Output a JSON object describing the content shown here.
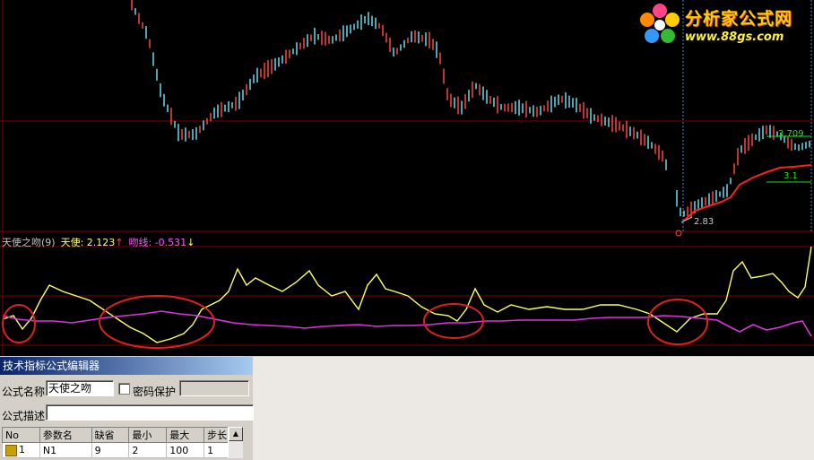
{
  "logo": {
    "title": "分析家公式网",
    "url": "www.88gs.com"
  },
  "indicator": {
    "name": "天使之吻(9)",
    "angel_label": "天使: 2.123",
    "kiss_label": "吻线: -0.531",
    "up_arrow": "↑",
    "down_arrow": "↓"
  },
  "price": {
    "low_label": "2.83",
    "tag_high": "3.709",
    "tag_low": "3.1"
  },
  "colors": {
    "angel": "#ffff66",
    "kiss": "#dd33dd",
    "ma": "#ff2020",
    "circle": "#e02020"
  },
  "editor": {
    "title": "技术指标公式编辑器",
    "formula_name_label": "公式名称",
    "formula_name_value": "天使之吻",
    "password_label": "密码保护",
    "description_label": "公式描述",
    "table": {
      "headers": [
        "No",
        "参数名",
        "缺省",
        "最小",
        "最大",
        "步长"
      ],
      "rows": [
        [
          "1",
          "N1",
          "9",
          "2",
          "100",
          "1"
        ]
      ]
    },
    "scroll_up": "▲"
  }
}
